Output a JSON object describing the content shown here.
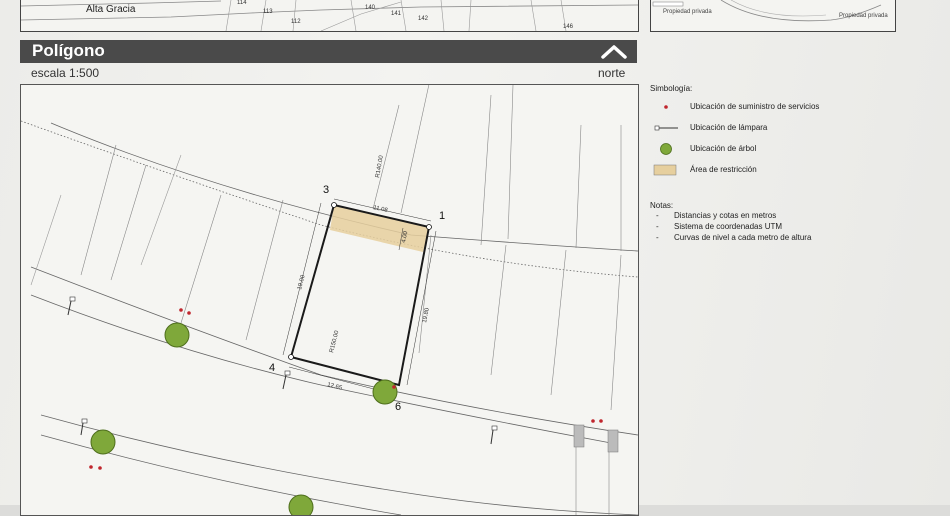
{
  "top_map": {
    "location": "Alta Gracia",
    "lots": [
      "114",
      "113",
      "112",
      "140",
      "141",
      "142",
      "146"
    ]
  },
  "top_right_map": {
    "labels": [
      "Propiedad privada",
      "Propiedad privada"
    ]
  },
  "header": {
    "title": "Polígono",
    "scale": "escala 1:500",
    "north": "norte"
  },
  "plan": {
    "vertex_labels": [
      "3",
      "1",
      "4",
      "6"
    ],
    "dimensions": [
      "11.08",
      "19.00",
      "4.00",
      "19.80",
      "12.65",
      "R140.00",
      "R150.00"
    ]
  },
  "legend": {
    "title": "Simbología:",
    "items": [
      {
        "label": "Ubicación de suministro de servicios",
        "icon": "service-point-icon"
      },
      {
        "label": "Ubicación de lámpara",
        "icon": "lamp-icon"
      },
      {
        "label": "Ubicación de árbol",
        "icon": "tree-icon"
      },
      {
        "label": "Área de restricción",
        "icon": "restriction-area-icon"
      }
    ]
  },
  "notes": {
    "title": "Notas:",
    "items": [
      "Distancias y cotas en metros",
      "Sistema de coordenadas UTM",
      "Curvas de nivel a cada metro de altura"
    ]
  },
  "colors": {
    "header_bg": "#4a4a4a",
    "lot_outline": "#1a1a1a",
    "restriction_fill": "#e6cf9e",
    "service_point": "#c0262d",
    "tree": "#7fa83a"
  }
}
